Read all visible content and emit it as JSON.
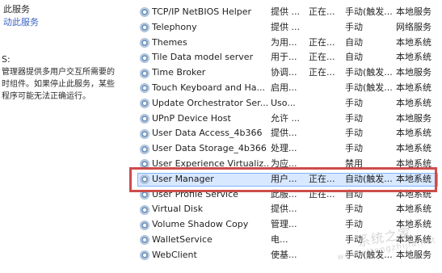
{
  "left_panel": {
    "links": [
      {
        "text": "此服务"
      },
      {
        "text": "动此服务"
      }
    ],
    "description_title": "S:",
    "description_text": "管理器提供多用户交互所需要的\n时组件。如果停止此服务，某些\n程序可能无法正确运行。"
  },
  "services": [
    {
      "name": "TCP/IP NetBIOS Helper",
      "description": "提供 ...",
      "status": "正在...",
      "startup": "手动(触发...",
      "logon": "本地服务"
    },
    {
      "name": "Telephony",
      "description": "提供 ...",
      "status": "",
      "startup": "手动",
      "logon": "网络服务"
    },
    {
      "name": "Themes",
      "description": "为用...",
      "status": "正在...",
      "startup": "自动",
      "logon": "本地系统"
    },
    {
      "name": "Tile Data model server",
      "description": "用于...",
      "status": "正在...",
      "startup": "自动",
      "logon": "本地系统"
    },
    {
      "name": "Time Broker",
      "description": "协调...",
      "status": "正在...",
      "startup": "手动(触发...",
      "logon": "本地服务"
    },
    {
      "name": "Touch Keyboard and Ha...",
      "description": "启用...",
      "status": "",
      "startup": "手动(触发...",
      "logon": "本地系统"
    },
    {
      "name": "Update Orchestrator Ser...",
      "description": "Uso...",
      "status": "",
      "startup": "手动",
      "logon": "本地系统"
    },
    {
      "name": "UPnP Device Host",
      "description": "允许 ...",
      "status": "",
      "startup": "手动",
      "logon": "本地服务"
    },
    {
      "name": "User Data Access_4b366",
      "description": "提供...",
      "status": "",
      "startup": "手动",
      "logon": "本地系统"
    },
    {
      "name": "User Data Storage_4b366",
      "description": "处理...",
      "status": "",
      "startup": "手动",
      "logon": "本地系统"
    },
    {
      "name": "User Experience Virtualiz...",
      "description": "为应...",
      "status": "",
      "startup": "禁用",
      "logon": "本地系统"
    },
    {
      "name": "User Manager",
      "description": "用户...",
      "status": "正在...",
      "startup": "自动(触发...",
      "logon": "本地系统"
    },
    {
      "name": "User Profile Service",
      "description": "此服...",
      "status": "正在...",
      "startup": "自动",
      "logon": "本地系统"
    },
    {
      "name": "Virtual Disk",
      "description": "提供...",
      "status": "",
      "startup": "手动",
      "logon": "本地系统"
    },
    {
      "name": "Volume Shadow Copy",
      "description": "管理...",
      "status": "",
      "startup": "手动",
      "logon": "本地系统"
    },
    {
      "name": "WalletService",
      "description": "电...",
      "status": "",
      "startup": "手动",
      "logon": "本地系统"
    },
    {
      "name": "WebClient",
      "description": "使基...",
      "status": "",
      "startup": "手动(触发...",
      "logon": "本地服务"
    }
  ],
  "selected_service": "User Manager",
  "watermark": {
    "line1": "系统之家",
    "line2": "www.xitongzhijia.net"
  }
}
